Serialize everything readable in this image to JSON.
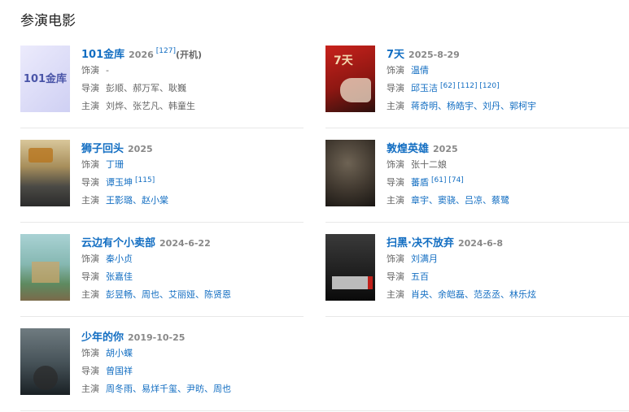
{
  "section": {
    "title": "参演电影"
  },
  "labels": {
    "role": "饰演",
    "director": "导演",
    "cast": "主演"
  },
  "movies": [
    {
      "title": "101金库",
      "date": "2026",
      "refs": "[127]",
      "extra": "(开机)",
      "role": "-",
      "directors": "彭顺、郝万军、耿巍",
      "director_refs": "",
      "cast": "刘烨、张艺凡、韩童生",
      "poster_text": "101金库",
      "poster_colors": [
        "#e8e6fb",
        "#cfd0f3"
      ]
    },
    {
      "title": "7天",
      "date": "2025-8-29",
      "refs": "",
      "extra": "",
      "role": "温倩",
      "directors": "邱玉洁",
      "director_refs": "[62] [112] [120]",
      "cast": "蒋奇明、杨皓宇、刘丹、郭柯宇",
      "poster_text": "7天",
      "poster_colors": [
        "#b01c1a",
        "#3a1410"
      ]
    },
    {
      "title": "狮子回头",
      "date": "2025",
      "refs": "",
      "extra": "",
      "role": "丁珊",
      "directors": "谭玉坤",
      "director_refs": "[115]",
      "cast": "王影璐、赵小棠",
      "poster_text": "",
      "poster_colors": [
        "#c7b080",
        "#3a3a3a"
      ]
    },
    {
      "title": "敦煌英雄",
      "date": "2025",
      "refs": "",
      "extra": "",
      "role": "张十二娘",
      "directors": "蕃盾",
      "director_refs": "[61] [74]",
      "cast": "章宇、窦骁、吕凉、蔡鹭",
      "poster_text": "",
      "poster_colors": [
        "#4a4238",
        "#1e1a16"
      ]
    },
    {
      "title": "云边有个小卖部",
      "date": "2024-6-22",
      "refs": "",
      "extra": "",
      "role": "秦小贞",
      "directors": "张嘉佳",
      "director_refs": "",
      "cast": "彭昱畅、周也、艾丽娅、陈贤恩",
      "poster_text": "",
      "poster_colors": [
        "#9cc6c8",
        "#4d7a5c"
      ]
    },
    {
      "title": "扫黑·决不放弃",
      "date": "2024-6-8",
      "refs": "",
      "extra": "",
      "role": "刘满月",
      "directors": "五百",
      "director_refs": "",
      "cast": "肖央、余皑磊、范丞丞、林乐炫",
      "poster_text": "",
      "poster_colors": [
        "#2b2b2b",
        "#0d0d0d"
      ]
    },
    {
      "title": "少年的你",
      "date": "2019-10-25",
      "refs": "",
      "extra": "",
      "role": "胡小蝶",
      "directors": "曾国祥",
      "director_refs": "",
      "cast": "周冬雨、易烊千玺、尹昉、周也",
      "poster_text": "",
      "poster_colors": [
        "#56636a",
        "#1b2226"
      ]
    }
  ]
}
